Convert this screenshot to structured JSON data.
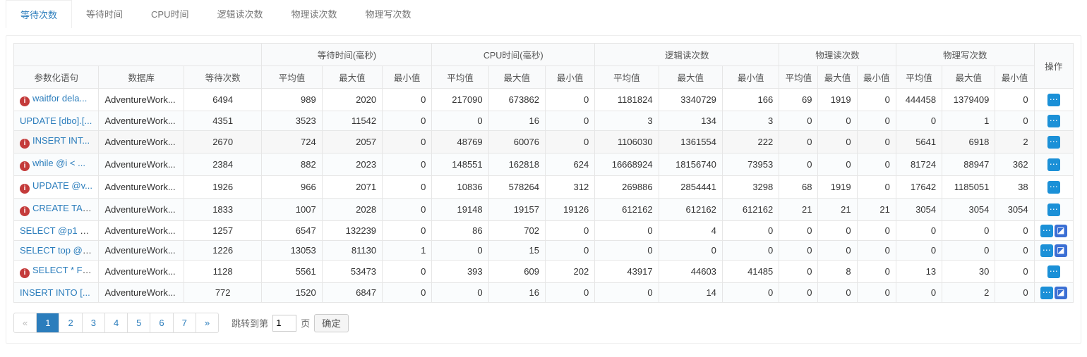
{
  "tabs": [
    "等待次数",
    "等待时间",
    "CPU时间",
    "逻辑读次数",
    "物理读次数",
    "物理写次数"
  ],
  "activeTab": 0,
  "headers": {
    "groups": [
      "",
      "等待时间(毫秒)",
      "CPU时间(毫秒)",
      "逻辑读次数",
      "物理读次数",
      "物理写次数"
    ],
    "cols": {
      "sql": "参数化语句",
      "db": "数据库",
      "waitCount": "等待次数",
      "avg": "平均值",
      "max": "最大值",
      "min": "最小值",
      "ops": "操作"
    }
  },
  "rows": [
    {
      "err": true,
      "sql": "waitfor dela...",
      "db": "AdventureWork...",
      "waitCount": 6494,
      "wt": {
        "avg": 989,
        "max": 2020,
        "min": 0
      },
      "cpu": {
        "avg": 217090,
        "max": 673862,
        "min": 0
      },
      "lr": {
        "avg": 1181824,
        "max": 3340729,
        "min": 166
      },
      "pr": {
        "avg": 69,
        "max": 1919,
        "min": 0
      },
      "pw": {
        "avg": 444458,
        "max": 1379409,
        "min": 0
      },
      "ops": [
        "more"
      ]
    },
    {
      "err": false,
      "sql": "UPDATE [dbo].[...",
      "db": "AdventureWork...",
      "waitCount": 4351,
      "wt": {
        "avg": 3523,
        "max": 11542,
        "min": 0
      },
      "cpu": {
        "avg": 0,
        "max": 16,
        "min": 0
      },
      "lr": {
        "avg": 3,
        "max": 134,
        "min": 3
      },
      "pr": {
        "avg": 0,
        "max": 0,
        "min": 0
      },
      "pw": {
        "avg": 0,
        "max": 1,
        "min": 0
      },
      "ops": [
        "more"
      ]
    },
    {
      "err": true,
      "sql": "INSERT INT...",
      "db": "AdventureWork...",
      "waitCount": 2670,
      "wt": {
        "avg": 724,
        "max": 2057,
        "min": 0
      },
      "cpu": {
        "avg": 48769,
        "max": 60076,
        "min": 0
      },
      "lr": {
        "avg": 1106030,
        "max": 1361554,
        "min": 222
      },
      "pr": {
        "avg": 0,
        "max": 0,
        "min": 0
      },
      "pw": {
        "avg": 5641,
        "max": 6918,
        "min": 2
      },
      "ops": [
        "more"
      ]
    },
    {
      "err": true,
      "sql": "while @i < ...",
      "db": "AdventureWork...",
      "waitCount": 2384,
      "wt": {
        "avg": 882,
        "max": 2023,
        "min": 0
      },
      "cpu": {
        "avg": 148551,
        "max": 162818,
        "min": 624
      },
      "lr": {
        "avg": 16668924,
        "max": 18156740,
        "min": 73953
      },
      "pr": {
        "avg": 0,
        "max": 0,
        "min": 0
      },
      "pw": {
        "avg": 81724,
        "max": 88947,
        "min": 362
      },
      "ops": [
        "more"
      ]
    },
    {
      "err": true,
      "sql": "UPDATE @v...",
      "db": "AdventureWork...",
      "waitCount": 1926,
      "wt": {
        "avg": 966,
        "max": 2071,
        "min": 0
      },
      "cpu": {
        "avg": 10836,
        "max": 578264,
        "min": 312
      },
      "lr": {
        "avg": 269886,
        "max": 2854441,
        "min": 3298
      },
      "pr": {
        "avg": 68,
        "max": 1919,
        "min": 0
      },
      "pw": {
        "avg": 17642,
        "max": 1185051,
        "min": 38
      },
      "ops": [
        "more"
      ]
    },
    {
      "err": true,
      "sql": "CREATE TAB...",
      "db": "AdventureWork...",
      "waitCount": 1833,
      "wt": {
        "avg": 1007,
        "max": 2028,
        "min": 0
      },
      "cpu": {
        "avg": 19148,
        "max": 19157,
        "min": 19126
      },
      "lr": {
        "avg": 612162,
        "max": 612162,
        "min": 612162
      },
      "pr": {
        "avg": 21,
        "max": 21,
        "min": 21
      },
      "pw": {
        "avg": 3054,
        "max": 3054,
        "min": 3054
      },
      "ops": [
        "more"
      ]
    },
    {
      "err": false,
      "sql": "SELECT @p1 = ...",
      "db": "AdventureWork...",
      "waitCount": 1257,
      "wt": {
        "avg": 6547,
        "max": 132239,
        "min": 0
      },
      "cpu": {
        "avg": 86,
        "max": 702,
        "min": 0
      },
      "lr": {
        "avg": 0,
        "max": 4,
        "min": 0
      },
      "pr": {
        "avg": 0,
        "max": 0,
        "min": 0
      },
      "pw": {
        "avg": 0,
        "max": 0,
        "min": 0
      },
      "ops": [
        "more",
        "link"
      ]
    },
    {
      "err": false,
      "sql": "SELECT top @v...",
      "db": "AdventureWork...",
      "waitCount": 1226,
      "wt": {
        "avg": 13053,
        "max": 81130,
        "min": 1
      },
      "cpu": {
        "avg": 0,
        "max": 15,
        "min": 0
      },
      "lr": {
        "avg": 0,
        "max": 0,
        "min": 0
      },
      "pr": {
        "avg": 0,
        "max": 0,
        "min": 0
      },
      "pw": {
        "avg": 0,
        "max": 0,
        "min": 0
      },
      "ops": [
        "more",
        "link"
      ]
    },
    {
      "err": true,
      "sql": "SELECT * FR...",
      "db": "AdventureWork...",
      "waitCount": 1128,
      "wt": {
        "avg": 5561,
        "max": 53473,
        "min": 0
      },
      "cpu": {
        "avg": 393,
        "max": 609,
        "min": 202
      },
      "lr": {
        "avg": 43917,
        "max": 44603,
        "min": 41485
      },
      "pr": {
        "avg": 0,
        "max": 8,
        "min": 0
      },
      "pw": {
        "avg": 13,
        "max": 30,
        "min": 0
      },
      "ops": [
        "more"
      ]
    },
    {
      "err": false,
      "sql": "INSERT INTO [...",
      "db": "AdventureWork...",
      "waitCount": 772,
      "wt": {
        "avg": 1520,
        "max": 6847,
        "min": 0
      },
      "cpu": {
        "avg": 0,
        "max": 16,
        "min": 0
      },
      "lr": {
        "avg": 0,
        "max": 14,
        "min": 0
      },
      "pr": {
        "avg": 0,
        "max": 0,
        "min": 0
      },
      "pw": {
        "avg": 0,
        "max": 2,
        "min": 0
      },
      "ops": [
        "more",
        "link"
      ]
    }
  ],
  "pager": {
    "pages": [
      "«",
      "1",
      "2",
      "3",
      "4",
      "5",
      "6",
      "7",
      "»"
    ],
    "active": 1,
    "disabled": 0,
    "jumpPrefix": "跳转到第",
    "jumpValue": "1",
    "jumpSuffix": "页",
    "confirm": "确定"
  }
}
